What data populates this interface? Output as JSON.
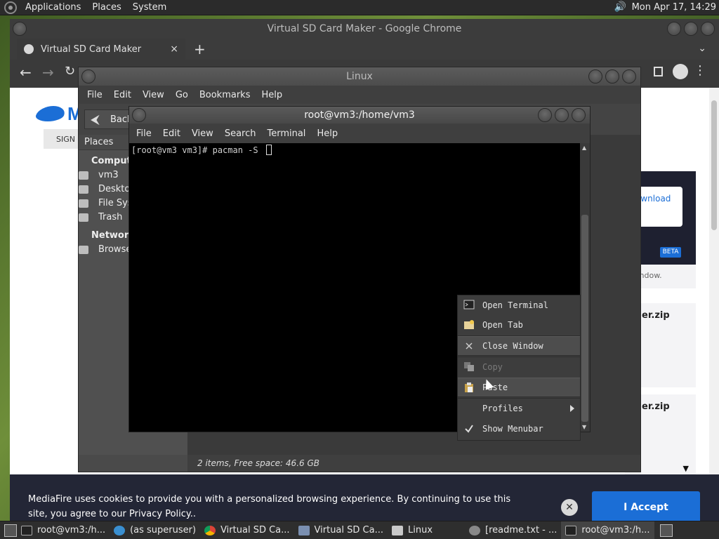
{
  "top_panel": {
    "menus": [
      "Applications",
      "Places",
      "System"
    ],
    "clock": "Mon Apr 17, 14:29"
  },
  "chrome": {
    "title": "Virtual SD Card Maker - Google Chrome",
    "tab_title": "Virtual SD Card Maker",
    "tab_close": "×",
    "new_tab": "+",
    "tab_menu": "⌄"
  },
  "web": {
    "logo_letter": "M",
    "sign_btn": "SIGN",
    "download_link": "ownload",
    "beta": "BETA",
    "window_text": "vndow.",
    "zip1": "er.zip",
    "zip2": "er.zip"
  },
  "cookie": {
    "text": "MediaFire uses cookies to provide you with a personalized browsing experience. By continuing to use this site, you agree to our Privacy Policy..",
    "close": "✕",
    "accept": "I Accept"
  },
  "file_manager": {
    "title": "Linux",
    "menu": [
      "File",
      "Edit",
      "View",
      "Go",
      "Bookmarks",
      "Help"
    ],
    "back_label": "Back",
    "places_header": "Places",
    "computer_group": "Computer",
    "items": [
      "vm3",
      "Desktop",
      "File System",
      "Trash"
    ],
    "network_group": "Network",
    "network_items": [
      "Browse Network"
    ],
    "status": "2 items, Free space: 46.6 GB"
  },
  "terminal": {
    "title": "root@vm3:/home/vm3",
    "menu": [
      "File",
      "Edit",
      "View",
      "Search",
      "Terminal",
      "Help"
    ],
    "prompt": "[root@vm3 vm3]# pacman -S "
  },
  "context_menu": {
    "items": [
      {
        "label": "Open Terminal",
        "icon": "terminal-icon",
        "state": "normal"
      },
      {
        "label": "Open Tab",
        "icon": "folder-tab-icon",
        "state": "normal"
      },
      {
        "label": "Close Window",
        "icon": "close-icon",
        "state": "selected"
      },
      {
        "label": "Copy",
        "icon": "copy-icon",
        "state": "disabled"
      },
      {
        "label": "Paste",
        "icon": "paste-icon",
        "state": "hover"
      },
      {
        "label": "Profiles",
        "icon": "",
        "state": "submenu"
      },
      {
        "label": "Show Menubar",
        "icon": "check-icon",
        "state": "checked"
      }
    ]
  },
  "taskbar": {
    "tasks": [
      "root@vm3:/h...",
      "(as superuser)",
      "Virtual SD Ca...",
      "Virtual SD Ca...",
      "Linux",
      "[readme.txt - ...",
      "root@vm3:/h..."
    ]
  },
  "colors": {
    "accent": "#1b6ed6",
    "cookie_bg": "#232636",
    "terminal_bg": "#000000"
  }
}
